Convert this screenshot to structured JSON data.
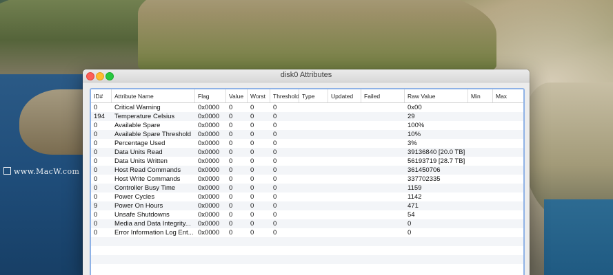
{
  "watermark": "www.MacW.com",
  "window": {
    "title": "disk0 Attributes"
  },
  "table": {
    "columns": [
      "ID#",
      "Attribute Name",
      "Flag",
      "Value",
      "Worst",
      "Threshold",
      "Type",
      "Updated",
      "Failed",
      "Raw Value",
      "Min",
      "Max"
    ],
    "rows": [
      [
        "0",
        "Critical Warning",
        "0x0000",
        "0",
        "0",
        "0",
        "",
        "",
        "",
        "0x00",
        "",
        ""
      ],
      [
        "194",
        "Temperature Celsius",
        "0x0000",
        "0",
        "0",
        "0",
        "",
        "",
        "",
        "29",
        "",
        ""
      ],
      [
        "0",
        "Available Spare",
        "0x0000",
        "0",
        "0",
        "0",
        "",
        "",
        "",
        "100%",
        "",
        ""
      ],
      [
        "0",
        "Available Spare Threshold",
        "0x0000",
        "0",
        "0",
        "0",
        "",
        "",
        "",
        "10%",
        "",
        ""
      ],
      [
        "0",
        "Percentage Used",
        "0x0000",
        "0",
        "0",
        "0",
        "",
        "",
        "",
        "3%",
        "",
        ""
      ],
      [
        "0",
        "Data Units Read",
        "0x0000",
        "0",
        "0",
        "0",
        "",
        "",
        "",
        "39136840 [20.0 TB]",
        "",
        ""
      ],
      [
        "0",
        "Data Units Written",
        "0x0000",
        "0",
        "0",
        "0",
        "",
        "",
        "",
        "56193719 [28.7 TB]",
        "",
        ""
      ],
      [
        "0",
        "Host Read Commands",
        "0x0000",
        "0",
        "0",
        "0",
        "",
        "",
        "",
        "361450706",
        "",
        ""
      ],
      [
        "0",
        "Host Write Commands",
        "0x0000",
        "0",
        "0",
        "0",
        "",
        "",
        "",
        "337702335",
        "",
        ""
      ],
      [
        "0",
        "Controller Busy Time",
        "0x0000",
        "0",
        "0",
        "0",
        "",
        "",
        "",
        "1159",
        "",
        ""
      ],
      [
        "0",
        "Power Cycles",
        "0x0000",
        "0",
        "0",
        "0",
        "",
        "",
        "",
        "1142",
        "",
        ""
      ],
      [
        "9",
        "Power On Hours",
        "0x0000",
        "0",
        "0",
        "0",
        "",
        "",
        "",
        "471",
        "",
        ""
      ],
      [
        "0",
        "Unsafe Shutdowns",
        "0x0000",
        "0",
        "0",
        "0",
        "",
        "",
        "",
        "54",
        "",
        ""
      ],
      [
        "0",
        "Media and Data Integrity...",
        "0x0000",
        "0",
        "0",
        "0",
        "",
        "",
        "",
        "0",
        "",
        ""
      ],
      [
        "0",
        "Error Information Log Ent...",
        "0x0000",
        "0",
        "0",
        "0",
        "",
        "",
        "",
        "0",
        "",
        ""
      ]
    ]
  }
}
